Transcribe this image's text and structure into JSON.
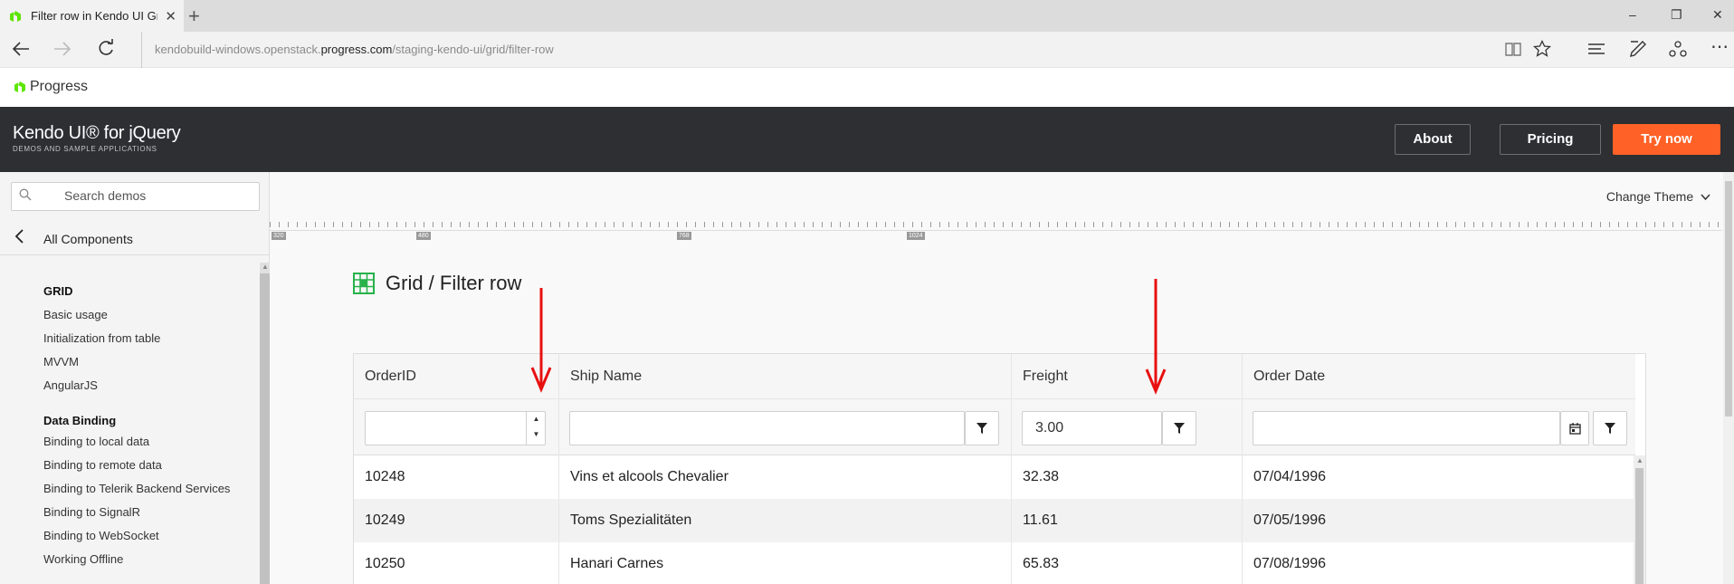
{
  "browser": {
    "tab_title": "Filter row in Kendo UI Grid",
    "url_prefix": "kendobuild-windows.openstack.",
    "url_domain": "progress.com",
    "url_path": "/staging-kendo-ui/grid/filter-row",
    "new_tab_glyph": "+",
    "tab_close_glyph": "✕",
    "window_controls": [
      "–",
      "❐",
      "✕"
    ]
  },
  "progress_logo": {
    "text": "Progress"
  },
  "header": {
    "title": "Kendo UI® for jQuery",
    "subtitle": "DEMOS AND SAMPLE APPLICATIONS",
    "about_label": "About",
    "pricing_label": "Pricing",
    "try_label": "Try now",
    "try_color": "#ff6126"
  },
  "sidebar": {
    "search_placeholder": "Search demos",
    "all_components": "All Components",
    "sections": [
      {
        "title": "GRID",
        "items": [
          "Basic usage",
          "Initialization from table",
          "MVVM",
          "AngularJS"
        ]
      },
      {
        "title": "Data Binding",
        "items": [
          "Binding to local data",
          "Binding to remote data",
          "Binding to Telerik Backend Services",
          "Binding to SignalR",
          "Binding to WebSocket",
          "Working Offline"
        ]
      }
    ]
  },
  "main": {
    "change_theme": "Change Theme",
    "ruler_marks": [
      "320",
      "480",
      "768",
      "1024"
    ],
    "page_title": "Grid / Filter row"
  },
  "grid": {
    "columns": [
      "OrderID",
      "Ship Name",
      "Freight",
      "Order Date"
    ],
    "filters": {
      "order_id": "",
      "ship_name": "",
      "freight": "3.00",
      "order_date": ""
    },
    "rows": [
      [
        "10248",
        "Vins et alcools Chevalier",
        "32.38",
        "07/04/1996"
      ],
      [
        "10249",
        "Toms Spezialitäten",
        "11.61",
        "07/05/1996"
      ],
      [
        "10250",
        "Hanari Carnes",
        "65.83",
        "07/08/1996"
      ]
    ]
  },
  "annotation_color": "#e81010"
}
